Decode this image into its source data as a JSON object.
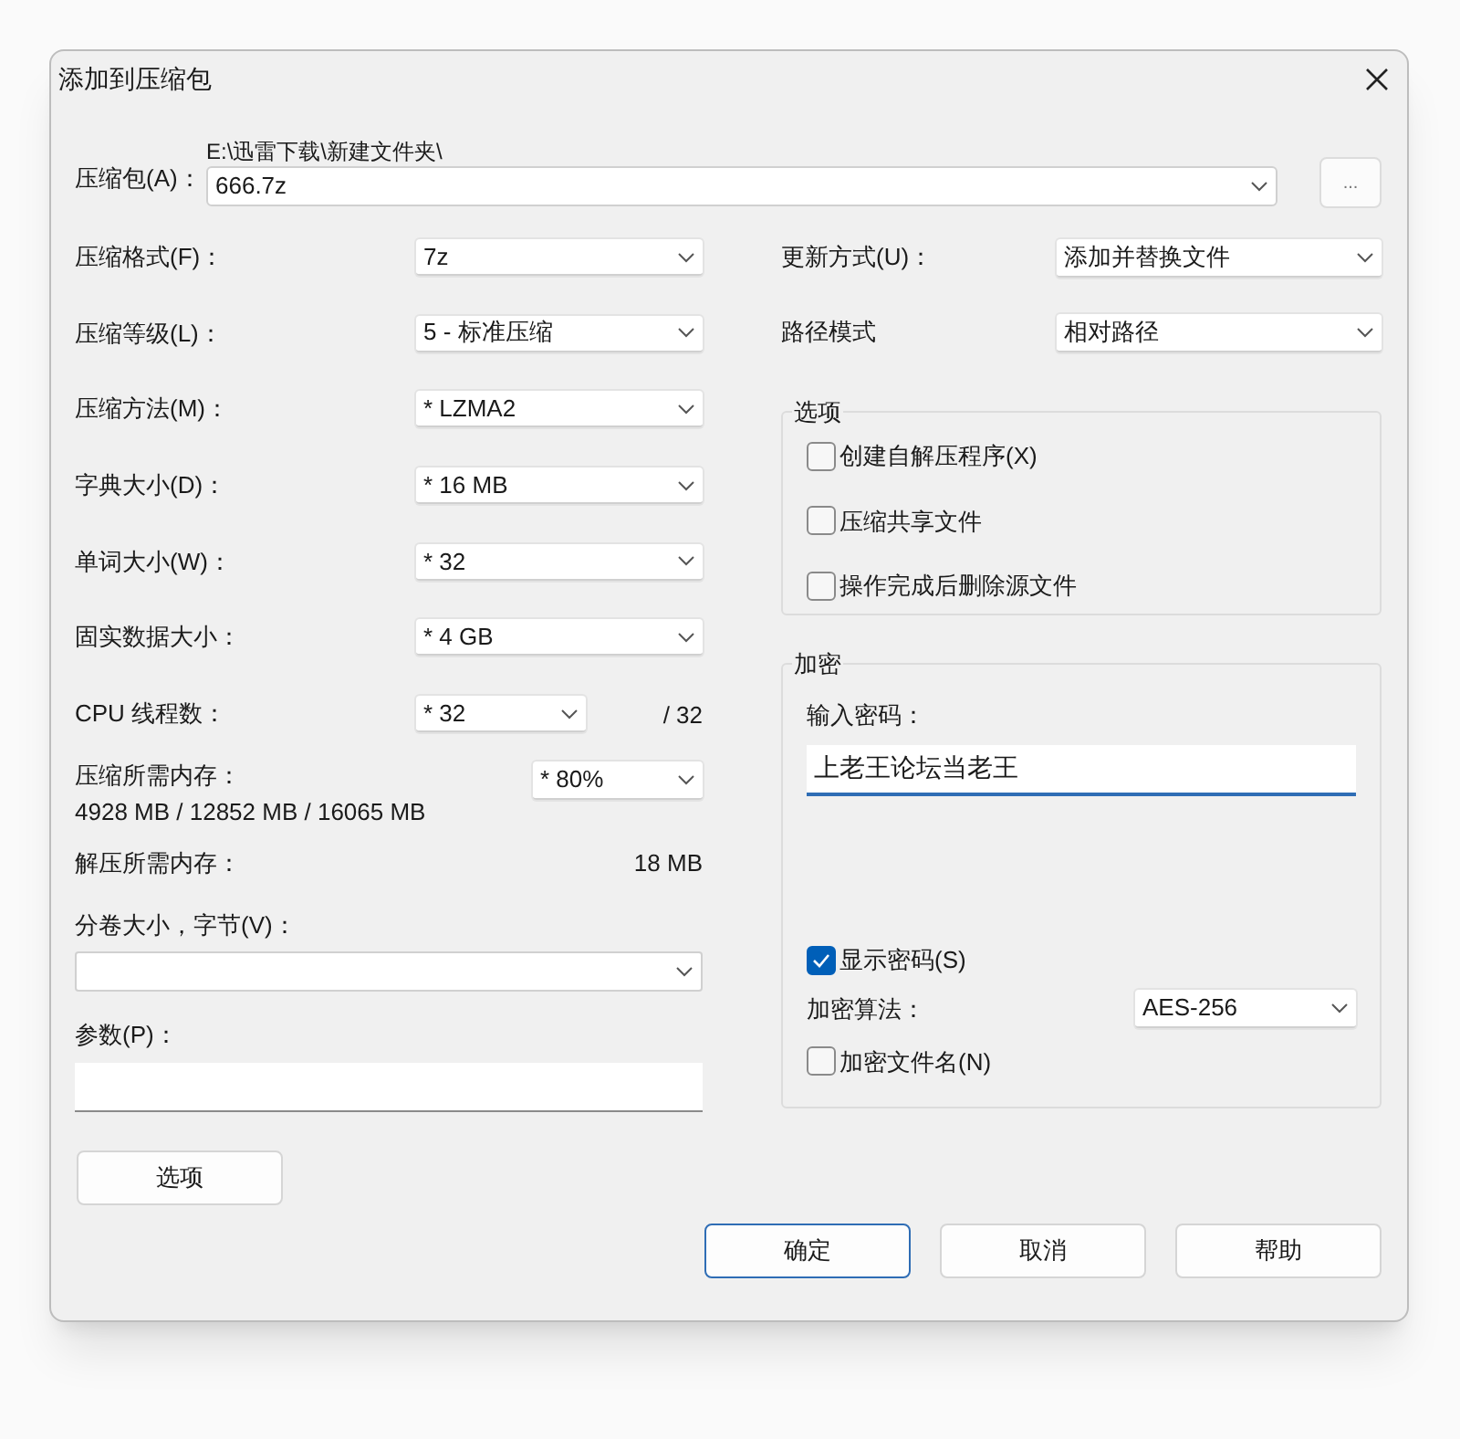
{
  "window": {
    "title": "添加到压缩包"
  },
  "archive": {
    "label": "压缩包(A)：",
    "path": "E:\\迅雷下载\\新建文件夹\\",
    "value": "666.7z",
    "browse": "..."
  },
  "left_fields": [
    {
      "kind": "select",
      "label": "压缩格式(F)：",
      "value": "7z"
    },
    {
      "kind": "select",
      "label": "压缩等级(L)：",
      "value": "5 - 标准压缩"
    },
    {
      "kind": "select",
      "label": "压缩方法(M)：",
      "value": "* LZMA2"
    },
    {
      "kind": "select",
      "label": "字典大小(D)：",
      "value": "* 16 MB"
    },
    {
      "kind": "select",
      "label": "单词大小(W)：",
      "value": "* 32"
    },
    {
      "kind": "select",
      "label": "固实数据大小：",
      "value": "* 4 GB"
    },
    {
      "kind": "select_suffix",
      "label": "CPU 线程数：",
      "value": "* 32",
      "suffix": "/ 32"
    },
    {
      "kind": "memory",
      "label": "压缩所需内存：",
      "detail": "4928 MB / 12852 MB / 16065 MB",
      "value": "* 80%"
    },
    {
      "kind": "info",
      "label": "解压所需内存：",
      "value": "18 MB"
    }
  ],
  "volume": {
    "label": "分卷大小，字节(V)："
  },
  "parameters": {
    "label": "参数(P)："
  },
  "options_button": "选项",
  "right_fields": [
    {
      "label": "更新方式(U)：",
      "value": "添加并替换文件"
    },
    {
      "label": "路径模式",
      "value": "相对路径"
    }
  ],
  "options_group": {
    "title": "选项",
    "items": [
      {
        "label": "创建自解压程序(X)",
        "checked": false
      },
      {
        "label": "压缩共享文件",
        "checked": false
      },
      {
        "label": "操作完成后删除源文件",
        "checked": false
      }
    ]
  },
  "encryption": {
    "title": "加密",
    "password_label": "输入密码：",
    "password": "上老王论坛当老王",
    "show_password": {
      "label": "显示密码(S)",
      "checked": true
    },
    "method_label": "加密算法：",
    "method": "AES-256",
    "encrypt_names": {
      "label": "加密文件名(N)",
      "checked": false
    }
  },
  "buttons": [
    {
      "label": "确定",
      "default": true
    },
    {
      "label": "取消",
      "default": false
    },
    {
      "label": "帮助",
      "default": false
    }
  ]
}
